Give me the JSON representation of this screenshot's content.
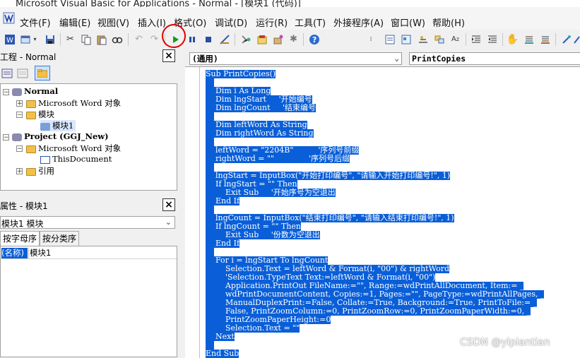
{
  "window": {
    "title": "Microsoft Visual Basic for Applications - Normal - [模块1 (代码)]"
  },
  "menu": [
    "文件(F)",
    "编辑(E)",
    "视图(V)",
    "插入(I)",
    "格式(O)",
    "调试(D)",
    "运行(R)",
    "工具(T)",
    "外接程序(A)",
    "窗口(W)",
    "帮助(H)"
  ],
  "project_panel": {
    "title": "工程 - Normal",
    "tree": [
      "Normal",
      "Microsoft Word 对象",
      "模块",
      "模块1",
      "Project (GGJ_New)",
      "Microsoft Word 对象",
      "ThisDocument",
      "引用"
    ]
  },
  "properties_panel": {
    "title": "属性 - 模块1",
    "combo_value": "模块1 模块",
    "tabs": [
      "按字母序",
      "按分类序"
    ],
    "rows": [
      {
        "name": "(名称)",
        "value": "模块1"
      }
    ]
  },
  "code_window": {
    "object_combo": "(通用)",
    "proc_combo": "PrintCopies",
    "lines": [
      "Sub PrintCopies()",
      "",
      "    Dim i As Long",
      "    Dim lngStart     '开始编号",
      "    Dim lngCount     '结束编号",
      "",
      "    Dim leftWord As String",
      "    Dim rightWord As String",
      "",
      "    leftWord = \"2204B\"          '序列号前缀",
      "    rightWord = \"\"              '序列号后缀",
      "",
      "    lngStart = InputBox(\"开始打印编号\", \"请输入开始打印编号!\", 1)",
      "    If lngStart = \"\" Then",
      "        Exit Sub     '开始序号为空退出",
      "    End If",
      "",
      "    lngCount = InputBox(\"结束打印编号\", \"请输入结束打印编号!\", 1)",
      "    If lngCount = \"\" Then",
      "        Exit Sub     '份数为空退出",
      "    End If",
      "",
      "    For i = lngStart To lngCount",
      "        Selection.Text = leftWord & Format(i, \"00\") & rightWord",
      "        'Selection.TypeText Text:=leftWord & Format(i, \"00\")",
      "        Application.PrintOut FileName:=\"\", Range:=wdPrintAllDocument, Item:= _",
      "        wdPrintDocumentContent, Copies:=1, Pages:=\"\", PageType:=wdPrintAllPages, _",
      "        ManualDuplexPrint:=False, Collate:=True, Background:=True, PrintToFile:= _",
      "        False, PrintZoomColumn:=0, PrintZoomRow:=0, PrintZoomPaperWidth:=0, _",
      "        PrintZoomPaperHeight:=0",
      "        Selection.Text = \"\"",
      "    Next",
      "",
      "End Sub"
    ]
  },
  "watermark": "CSDN @yipiantian",
  "colors": {
    "selection": "#0a5fd8",
    "highlight_ring": "#e00000",
    "run_icon": "#1a9a1a"
  }
}
